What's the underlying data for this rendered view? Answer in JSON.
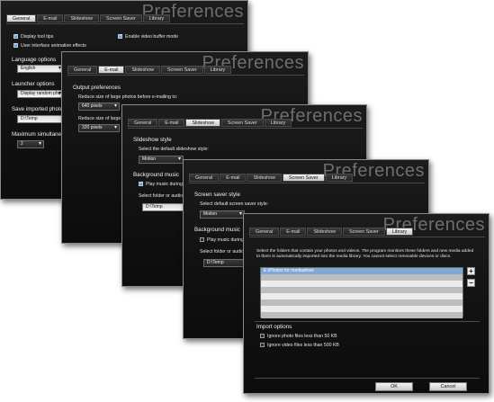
{
  "app_title": "Preferences",
  "tabs": [
    "General",
    "E-mail",
    "Slideshow",
    "Screen Saver",
    "Library"
  ],
  "general": {
    "display_tool_tips": "Display tool tips",
    "ui_animation": "User interface animation effects",
    "enable_video_buffer": "Enable video buffer mode",
    "language_options": "Language options",
    "language_value": "English",
    "launcher_options": "Launcher options",
    "launcher_value": "Display random photo",
    "save_imported": "Save imported photos",
    "save_imported_path": "D:\\Temp",
    "max_simultaneous": "Maximum simultaneous",
    "max_simultaneous_value": "2"
  },
  "email": {
    "output_prefs": "Output preferences",
    "reduce_photos": "Reduce size of large photos before e-mailing to:",
    "photos_value": "640 pixels",
    "reduce_video": "Reduce size of large vid",
    "video_value": "320 pixels"
  },
  "slideshow": {
    "style_head": "Slideshow style",
    "select_default": "Select the default slideshow style:",
    "style_value": "Motion",
    "bg_music": "Background music",
    "play_music": "Play music during sl",
    "select_folder": "Select folder or audio fi",
    "folder_value": "D:\\Temp"
  },
  "screensaver": {
    "style_head": "Screen saver style",
    "select_default": "Select default screen saver style:",
    "style_value": "Motion",
    "bg_music": "Background music",
    "play_music": "Play music during sc",
    "select_folder": "Select folder or audio fi",
    "folder_value": "D:\\Temp"
  },
  "library": {
    "description": "Select the folders that contain your photos and videos. The program monitors these folders and new media added to them is automatically imported into the media library. You cannot select removable devices or discs.",
    "folders": [
      "E:\\Photos for mediashow"
    ],
    "add_symbol": "+",
    "remove_symbol": "−",
    "import_options": "Import options",
    "ignore_photos": "Ignore photo files less than 50 KB",
    "ignore_videos": "Ignore video files less than 500 KB",
    "ok": "OK",
    "cancel": "Cancel"
  },
  "colors": {
    "selection": "#7fa7d8",
    "active_tab": "#f2f2f2"
  }
}
